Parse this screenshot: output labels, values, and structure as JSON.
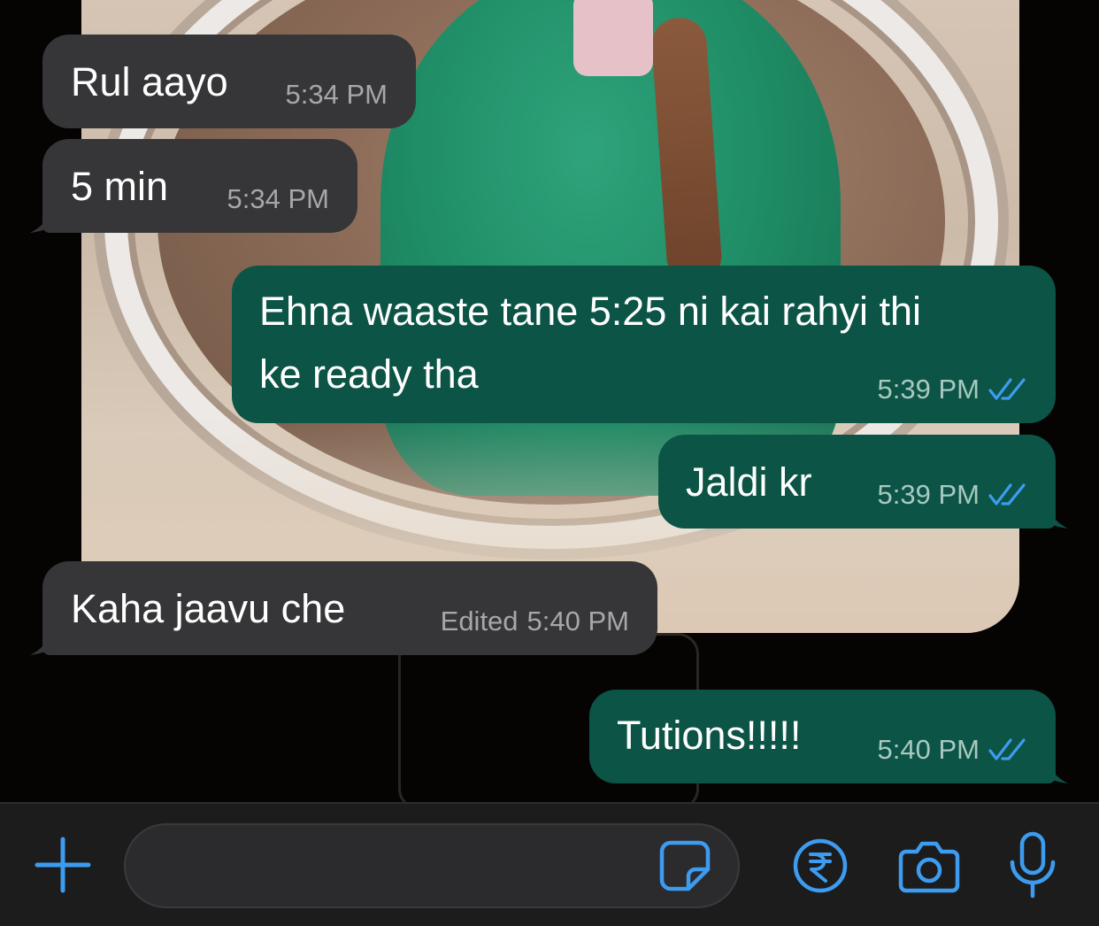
{
  "colors": {
    "incoming_bubble": "#363638",
    "outgoing_bubble": "#0c5446",
    "accent_blue": "#3d9cf0",
    "composer_bg": "#1c1c1d"
  },
  "messages": [
    {
      "direction": "incoming",
      "text": "Rul aayo",
      "time": "5:34 PM"
    },
    {
      "direction": "incoming",
      "text": "5 min",
      "time": "5:34 PM"
    },
    {
      "direction": "outgoing",
      "lines": [
        "Ehna waaste tane 5:25 ni kai rahyi thi",
        "ke ready tha"
      ],
      "time": "5:39 PM",
      "status_icon": "double-check-icon"
    },
    {
      "direction": "outgoing",
      "text": "Jaldi kr",
      "time": "5:39 PM",
      "status_icon": "double-check-icon"
    },
    {
      "direction": "incoming",
      "text": "Kaha jaavu che",
      "edited_label": "Edited",
      "time": "5:40 PM"
    },
    {
      "direction": "outgoing",
      "text": "Tutions!!!!!",
      "time": "5:40 PM",
      "status_icon": "double-check-icon"
    }
  ],
  "composer": {
    "input_value": "",
    "icons": [
      "plus-icon",
      "sticker-icon",
      "rupee-payment-icon",
      "camera-icon",
      "microphone-icon"
    ]
  }
}
